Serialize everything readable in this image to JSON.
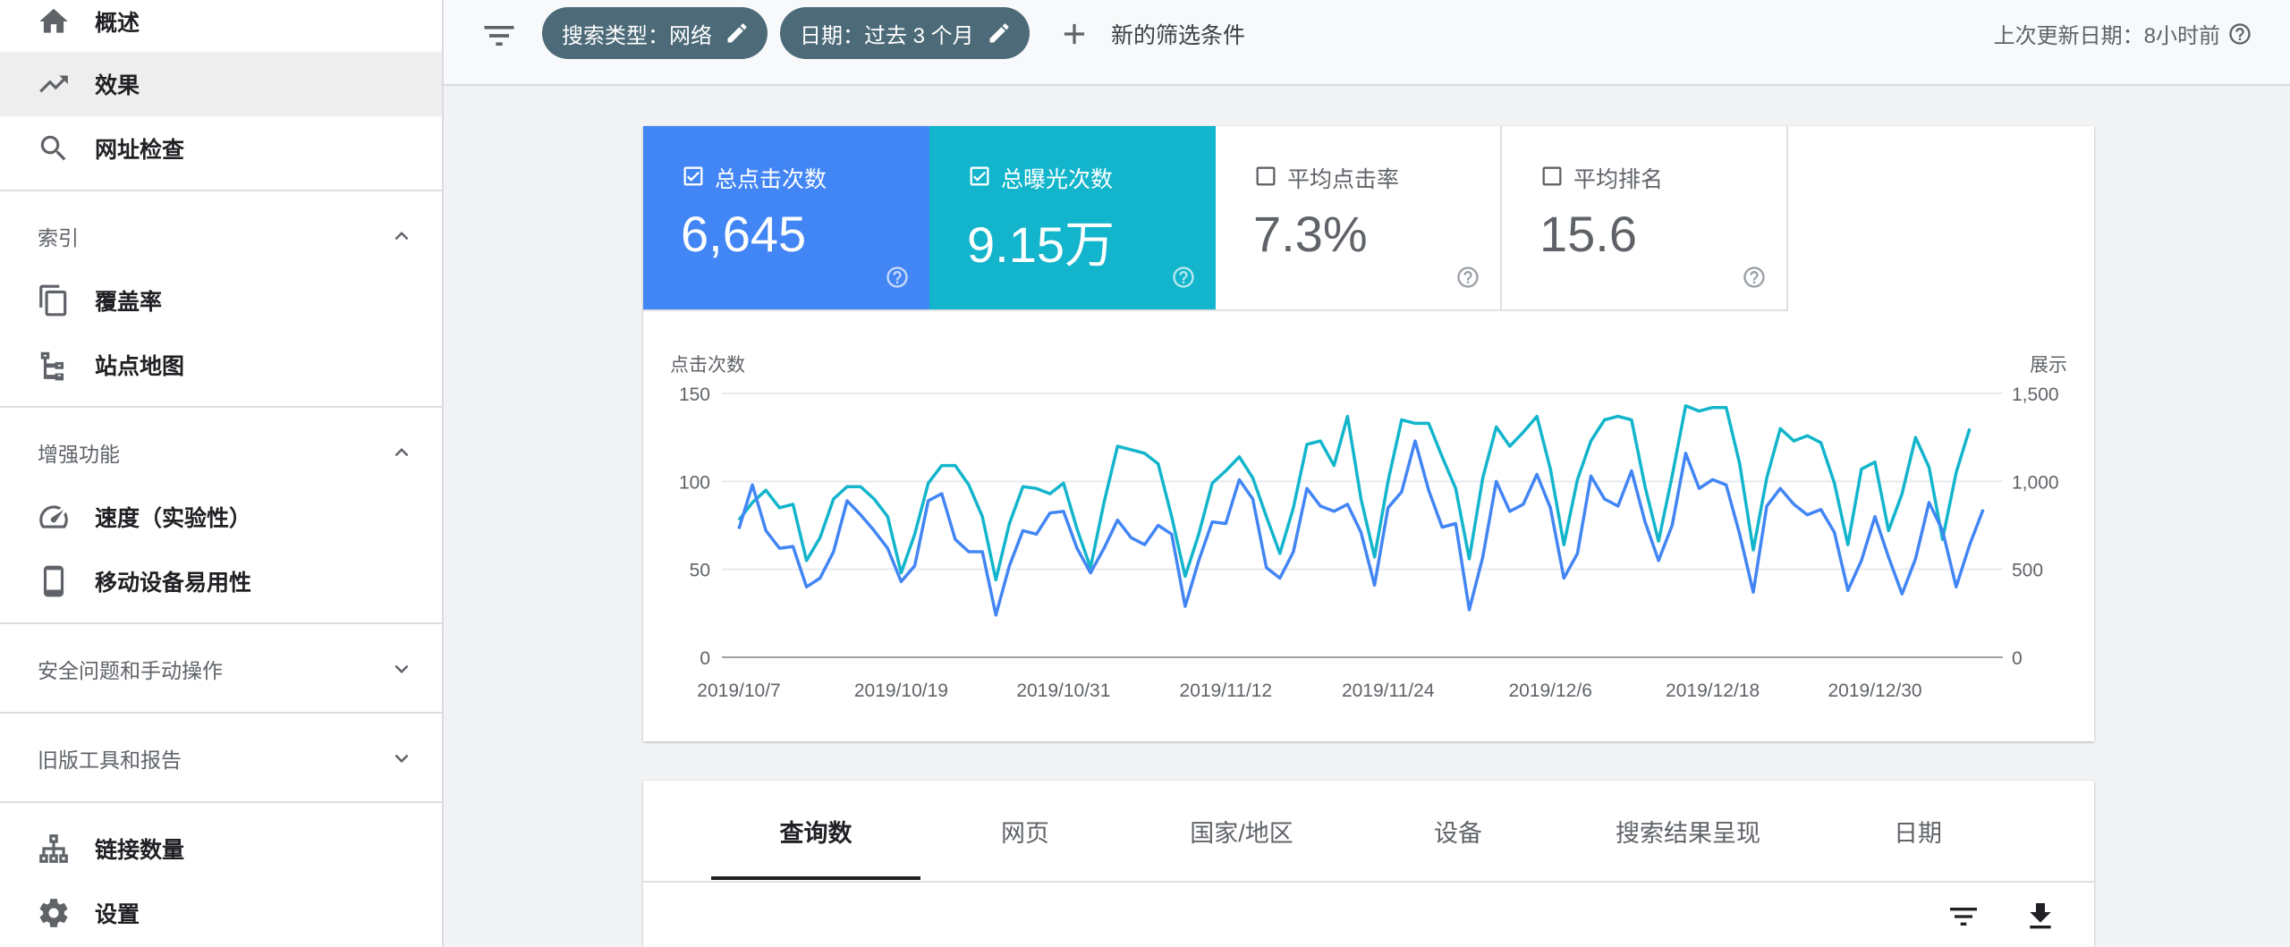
{
  "sidebar": {
    "items": [
      {
        "label": "概述",
        "icon": "home-icon"
      },
      {
        "label": "效果",
        "icon": "trending-up-icon"
      },
      {
        "label": "网址检查",
        "icon": "search-icon"
      }
    ],
    "sections": [
      {
        "label": "索引",
        "expanded": true,
        "items": [
          {
            "label": "覆盖率",
            "icon": "copy-icon"
          },
          {
            "label": "站点地图",
            "icon": "sitemap-icon"
          }
        ]
      },
      {
        "label": "增强功能",
        "expanded": true,
        "items": [
          {
            "label": "速度（实验性）",
            "icon": "speed-icon"
          },
          {
            "label": "移动设备易用性",
            "icon": "phone-icon"
          }
        ]
      },
      {
        "label": "安全问题和手动操作",
        "expanded": false
      },
      {
        "label": "旧版工具和报告",
        "expanded": false
      }
    ],
    "bottom_items": [
      {
        "label": "链接数量",
        "icon": "links-icon"
      },
      {
        "label": "设置",
        "icon": "settings-icon"
      }
    ]
  },
  "topbar": {
    "chips": [
      {
        "label": "搜索类型：网络"
      },
      {
        "label": "日期：过去 3 个月"
      }
    ],
    "add_filter": "新的筛选条件",
    "last_updated": "上次更新日期：8小时前"
  },
  "metrics": [
    {
      "label": "总点击次数",
      "value": "6,645",
      "checked": true,
      "color": "#4285f4"
    },
    {
      "label": "总曝光次数",
      "value": "9.15万",
      "checked": true,
      "color": "#12b5cb"
    },
    {
      "label": "平均点击率",
      "value": "7.3%",
      "checked": false,
      "color": "#ffffff"
    },
    {
      "label": "平均排名",
      "value": "15.6",
      "checked": false,
      "color": "#ffffff"
    }
  ],
  "chart_data": {
    "type": "line",
    "ylabel": "点击次数",
    "y2label": "展示",
    "ylim": [
      0,
      150
    ],
    "y2lim": [
      0,
      1500
    ],
    "yticks": [
      "150",
      "100",
      "50",
      "0"
    ],
    "y2ticks": [
      "1,500",
      "1,000",
      "500",
      "0"
    ],
    "xtick_labels": [
      "2019/10/7",
      "2019/10/19",
      "2019/10/31",
      "2019/11/12",
      "2019/11/24",
      "2019/12/6",
      "2019/12/18",
      "2019/12/30"
    ],
    "x_start": "2019/10/7",
    "series": [
      {
        "axis": "left",
        "color": "#4285f4",
        "values": [
          73,
          98,
          72,
          62,
          63,
          40,
          45,
          60,
          89,
          81,
          72,
          62,
          43,
          52,
          89,
          93,
          67,
          60,
          60,
          24,
          52,
          72,
          70,
          82,
          83,
          62,
          48,
          62,
          78,
          68,
          64,
          75,
          70,
          29,
          55,
          77,
          76,
          101,
          90,
          51,
          45,
          60,
          96,
          86,
          83,
          87,
          71,
          41,
          85,
          94,
          123,
          95,
          74,
          76,
          27,
          57,
          100,
          83,
          87,
          104,
          85,
          45,
          59,
          103,
          90,
          86,
          106,
          77,
          55,
          75,
          116,
          96,
          101,
          98,
          70,
          37,
          86,
          96,
          87,
          81,
          84,
          71,
          38,
          55,
          80,
          57,
          36,
          56,
          88,
          72,
          40,
          64,
          84
        ]
      },
      {
        "axis": "right",
        "color": "#12b5cb",
        "values": [
          780,
          880,
          950,
          850,
          870,
          550,
          680,
          900,
          970,
          970,
          900,
          800,
          480,
          700,
          990,
          1090,
          1090,
          980,
          800,
          440,
          760,
          970,
          960,
          930,
          990,
          730,
          510,
          880,
          1200,
          1180,
          1160,
          1100,
          800,
          460,
          700,
          990,
          1060,
          1140,
          1020,
          800,
          590,
          850,
          1210,
          1230,
          1090,
          1370,
          900,
          570,
          1000,
          1350,
          1330,
          1330,
          1140,
          960,
          560,
          1020,
          1310,
          1200,
          1280,
          1370,
          1070,
          640,
          1010,
          1230,
          1350,
          1370,
          1350,
          970,
          660,
          1030,
          1430,
          1400,
          1420,
          1420,
          1100,
          610,
          1020,
          1300,
          1230,
          1260,
          1220,
          990,
          640,
          1070,
          1110,
          720,
          930,
          1250,
          1080,
          670,
          1050,
          1300
        ]
      }
    ]
  },
  "tabs": {
    "items": [
      "查询数",
      "网页",
      "国家/地区",
      "设备",
      "搜索结果呈现",
      "日期"
    ],
    "active": 0
  }
}
